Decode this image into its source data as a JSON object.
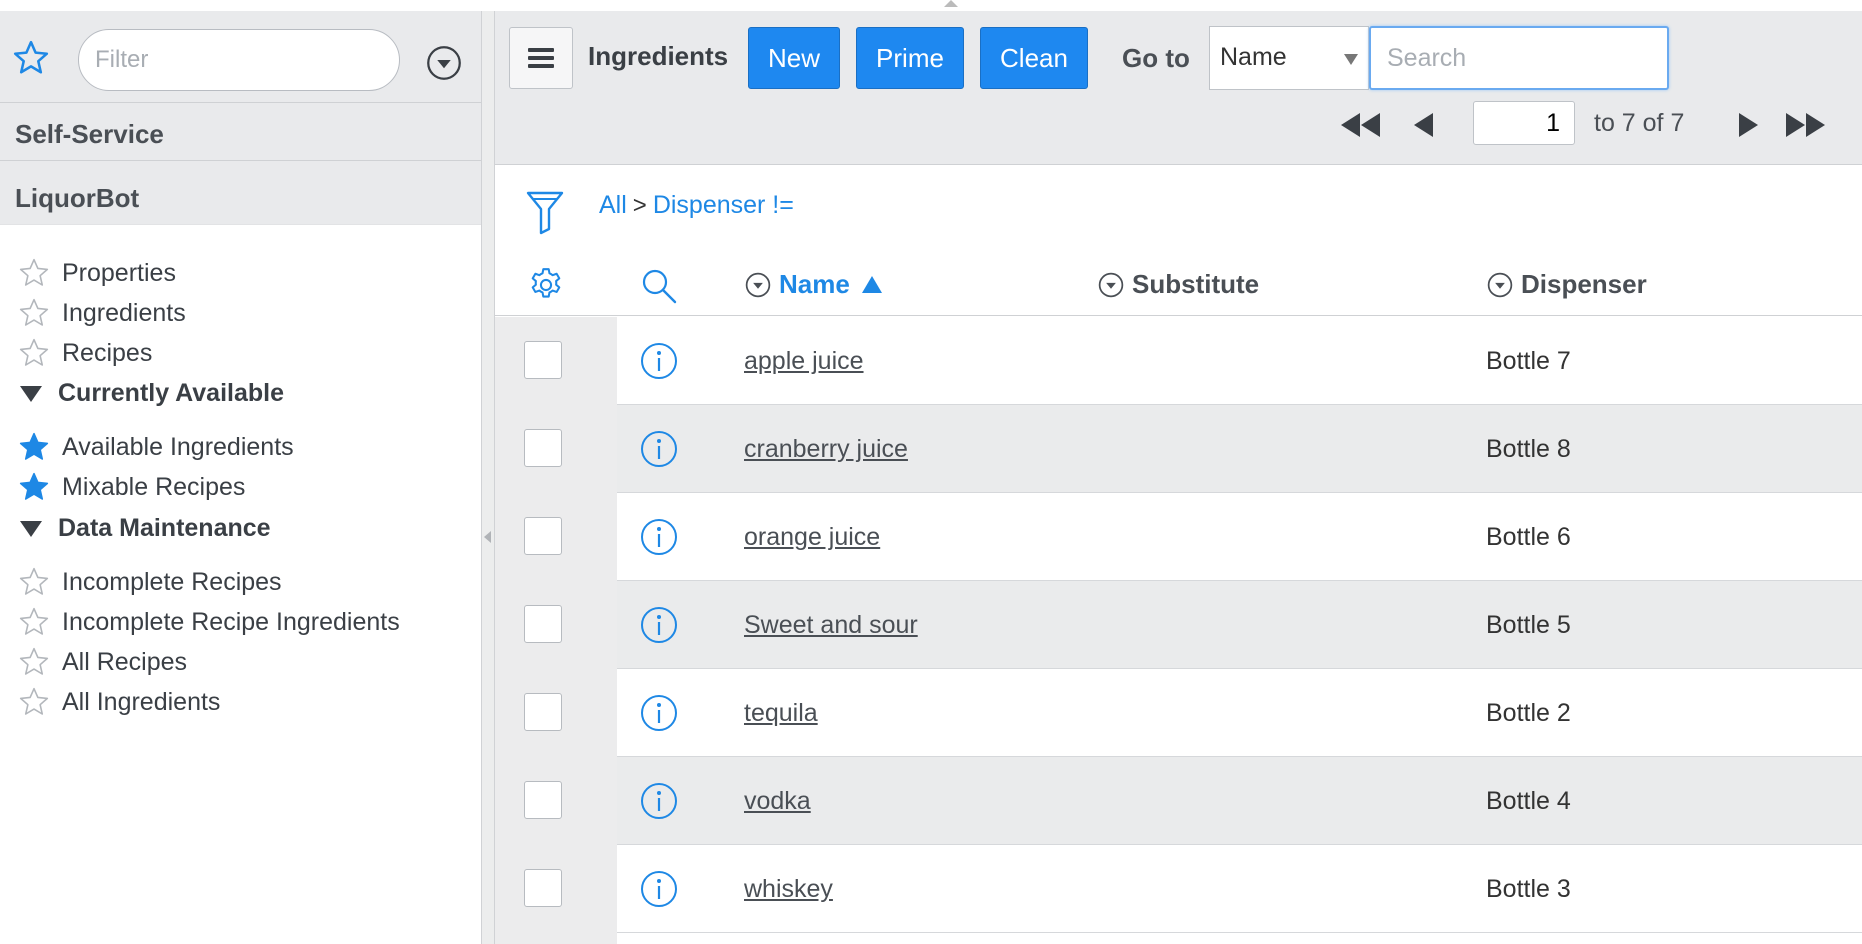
{
  "sidebar": {
    "filter_placeholder": "Filter",
    "sections": {
      "self_service": "Self-Service",
      "liquorbot": "LiquorBot"
    },
    "items": [
      {
        "label": "Properties",
        "starred": false
      },
      {
        "label": "Ingredients",
        "starred": false
      },
      {
        "label": "Recipes",
        "starred": false
      }
    ],
    "groups": [
      {
        "label": "Currently Available",
        "items": [
          {
            "label": "Available Ingredients",
            "starred": true
          },
          {
            "label": "Mixable Recipes",
            "starred": true
          }
        ]
      },
      {
        "label": "Data Maintenance",
        "items": [
          {
            "label": "Incomplete Recipes",
            "starred": false
          },
          {
            "label": "Incomplete Recipe Ingredients",
            "starred": false
          },
          {
            "label": "All Recipes",
            "starred": false
          },
          {
            "label": "All Ingredients",
            "starred": false
          }
        ]
      }
    ]
  },
  "toolbar": {
    "title": "Ingredients",
    "new_label": "New",
    "prime_label": "Prime",
    "clean_label": "Clean",
    "goto_label": "Go to",
    "goto_value": "Name",
    "search_placeholder": "Search"
  },
  "pager": {
    "page": "1",
    "of_text": "to 7 of 7"
  },
  "breadcrumb": {
    "all": "All",
    "sep": ">",
    "filter": "Dispenser !="
  },
  "table": {
    "columns": {
      "name": "Name",
      "substitute": "Substitute",
      "dispenser": "Dispenser"
    },
    "rows": [
      {
        "name": "apple juice",
        "substitute": "",
        "dispenser": "Bottle 7"
      },
      {
        "name": "cranberry juice",
        "substitute": "",
        "dispenser": "Bottle 8"
      },
      {
        "name": "orange juice",
        "substitute": "",
        "dispenser": "Bottle 6"
      },
      {
        "name": "Sweet and sour",
        "substitute": "",
        "dispenser": "Bottle 5"
      },
      {
        "name": "tequila",
        "substitute": "",
        "dispenser": "Bottle 2"
      },
      {
        "name": "vodka",
        "substitute": "",
        "dispenser": "Bottle 4"
      },
      {
        "name": "whiskey",
        "substitute": "",
        "dispenser": "Bottle 3"
      }
    ]
  },
  "colors": {
    "accent": "#1e88f0",
    "link": "#1e88e5",
    "panel": "#e9eaec"
  },
  "icons": [
    "star-icon",
    "chevron-down-icon",
    "hamburger-icon",
    "first-page-icon",
    "prev-page-icon",
    "next-page-icon",
    "last-page-icon",
    "funnel-icon",
    "gear-icon",
    "search-icon",
    "info-icon"
  ]
}
